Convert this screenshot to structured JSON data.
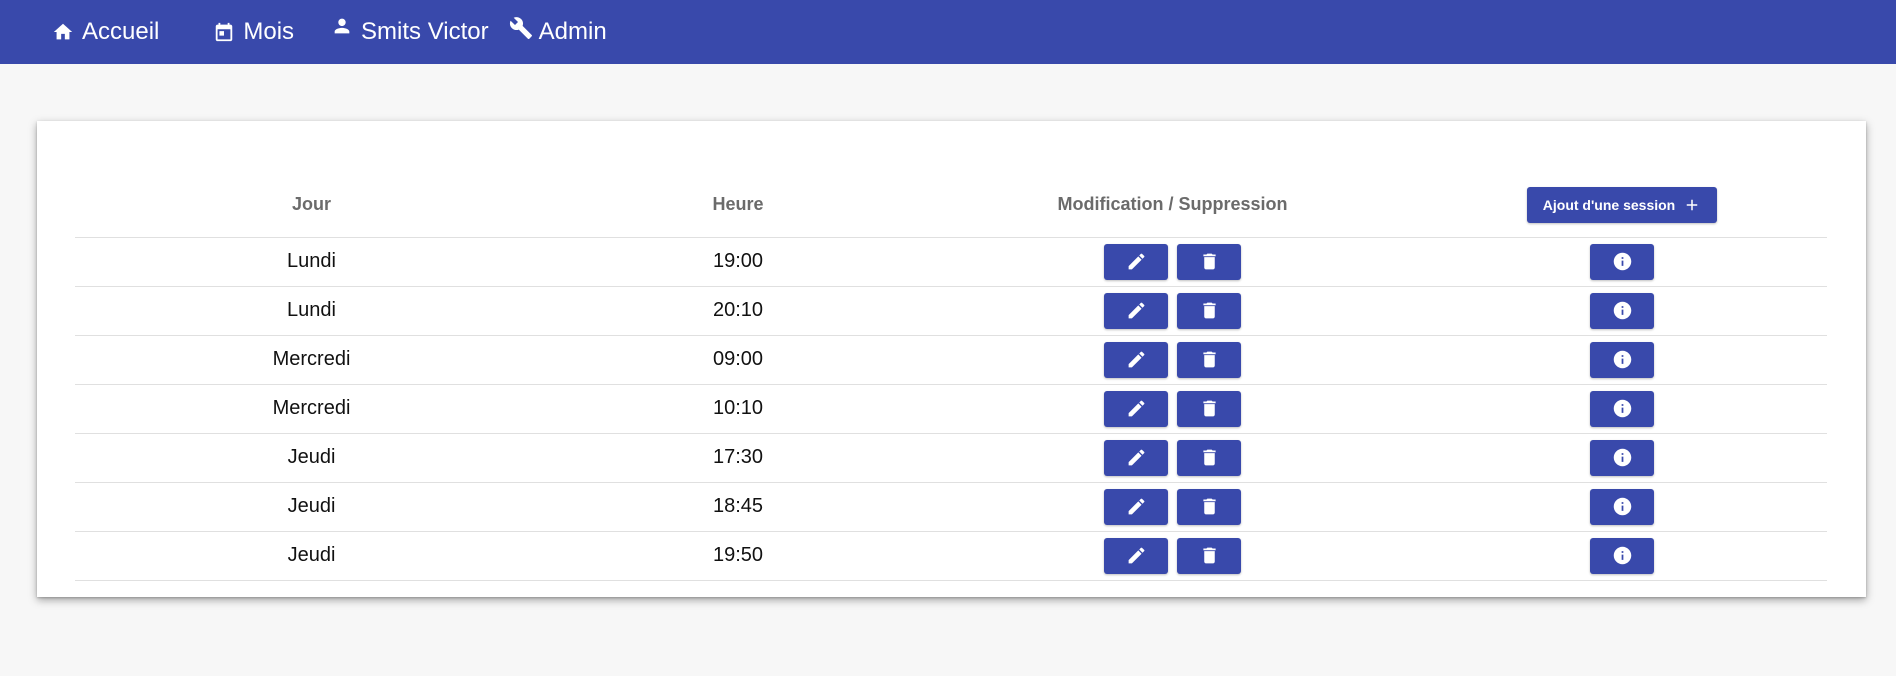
{
  "nav": {
    "home": {
      "label": "Accueil",
      "icon": "home-icon"
    },
    "month": {
      "label": "Mois",
      "icon": "calendar-icon"
    },
    "user": {
      "label": "Smits Victor",
      "icon": "person-icon"
    },
    "admin": {
      "label": "Admin",
      "icon": "wrench-icon"
    }
  },
  "colors": {
    "primary": "#3949ab",
    "background": "#f7f7f7"
  },
  "table": {
    "headers": {
      "day": "Jour",
      "time": "Heure",
      "actions": "Modification / Suppression",
      "add_button": "Ajout d'une session"
    },
    "rows": [
      {
        "day": "Lundi",
        "time": "19:00"
      },
      {
        "day": "Lundi",
        "time": "20:10"
      },
      {
        "day": "Mercredi",
        "time": "09:00"
      },
      {
        "day": "Mercredi",
        "time": "10:10"
      },
      {
        "day": "Jeudi",
        "time": "17:30"
      },
      {
        "day": "Jeudi",
        "time": "18:45"
      },
      {
        "day": "Jeudi",
        "time": "19:50"
      }
    ],
    "row_icons": {
      "edit": "pencil-icon",
      "delete": "trash-icon",
      "info": "info-icon"
    }
  }
}
